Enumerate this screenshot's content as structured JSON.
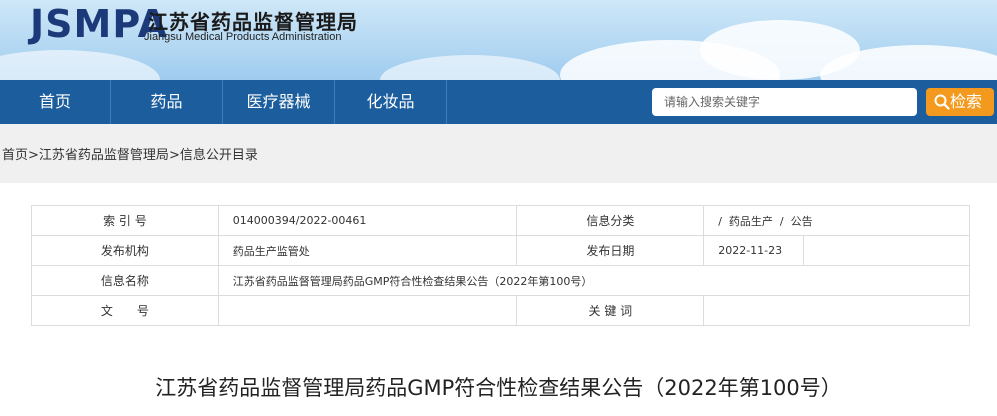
{
  "header": {
    "logo_text": "JSMPA",
    "org_cn": "江苏省药品监督管理局",
    "org_en": "Jiangsu Medical Products Administration"
  },
  "nav": {
    "items": [
      "首页",
      "药品",
      "医疗器械",
      "化妆品"
    ],
    "search_placeholder": "请输入搜索关键字",
    "search_button": "检索"
  },
  "breadcrumb": {
    "home": "首页",
    "sep": ">",
    "level1": "江苏省药品监督管理局",
    "level2": "信息公开目录"
  },
  "info_table": {
    "index_label": "索 引 号",
    "index_value": "014000394/2022-00461",
    "category_label": "信息分类",
    "category_value": "/  药品生产  /  公告",
    "publisher_label": "发布机构",
    "publisher_value": "药品生产监管处",
    "date_label": "发布日期",
    "date_value": "2022-11-23",
    "name_label": "信息名称",
    "name_value": "江苏省药品监督管理局药品GMP符合性检查结果公告（2022年第100号）",
    "docno_label": "文　　号",
    "docno_value": "",
    "keywords_label": "关 键 词",
    "keywords_value": ""
  },
  "article": {
    "title": "江苏省药品监督管理局药品GMP符合性检查结果公告（2022年第100号）"
  },
  "colors": {
    "nav_bg": "#1c5d9e",
    "search_btn": "#f39a1e",
    "logo": "#1c3a7a"
  }
}
